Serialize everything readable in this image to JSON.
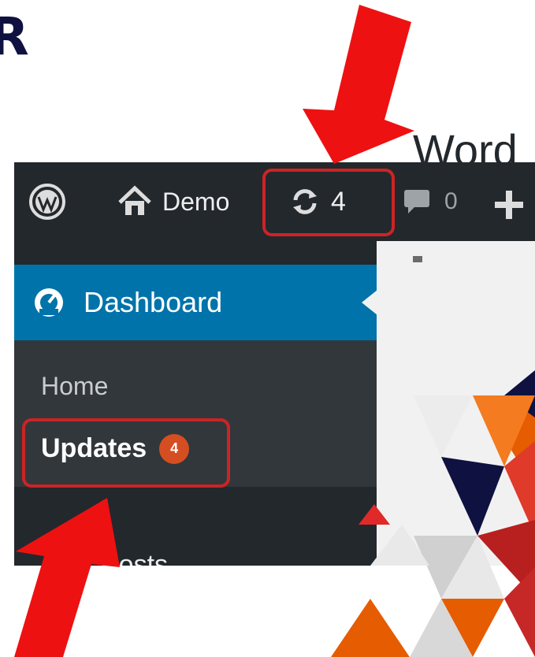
{
  "corner_text": "R",
  "admin_bar": {
    "site_name": "Demo",
    "updates_count": "4",
    "comments_count": "0",
    "icons": {
      "logo": "wordpress-logo-icon",
      "home": "home-icon",
      "updates": "refresh-icon",
      "comments": "comment-bubble-icon",
      "new": "plus-icon"
    }
  },
  "sidebar": {
    "dashboard_label": "Dashboard",
    "dashboard_icon": "dashboard-gauge-icon",
    "submenu": {
      "home_label": "Home",
      "updates_label": "Updates",
      "updates_badge": "4"
    },
    "next_item_partial": "Posts"
  },
  "content": {
    "title_partial": "Word"
  },
  "colors": {
    "admin_bar": "#23282d",
    "active_menu": "#0073aa",
    "submenu_bg": "#32373c",
    "badge": "#d54e21",
    "highlight": "#cc2424",
    "arrow": "#ee1111",
    "triangle_navy": "#0f1140",
    "triangle_orange": "#e65c00"
  }
}
